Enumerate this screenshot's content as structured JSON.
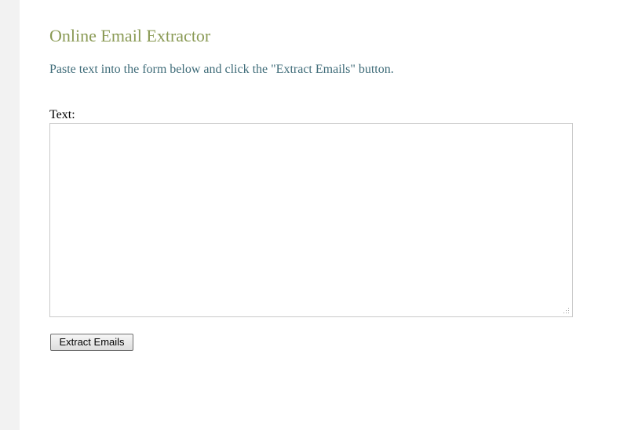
{
  "page": {
    "title": "Online Email Extractor",
    "instructions": "Paste text into the form below and click the \"Extract Emails\" button."
  },
  "form": {
    "text_label": "Text:",
    "text_value": "",
    "submit_label": "Extract Emails"
  },
  "colors": {
    "title": "#8a9a55",
    "instructions": "#3e6b78",
    "left_strip": "#f2f2f2"
  },
  "icons": {
    "resize_grip": "resize-grip-icon"
  }
}
